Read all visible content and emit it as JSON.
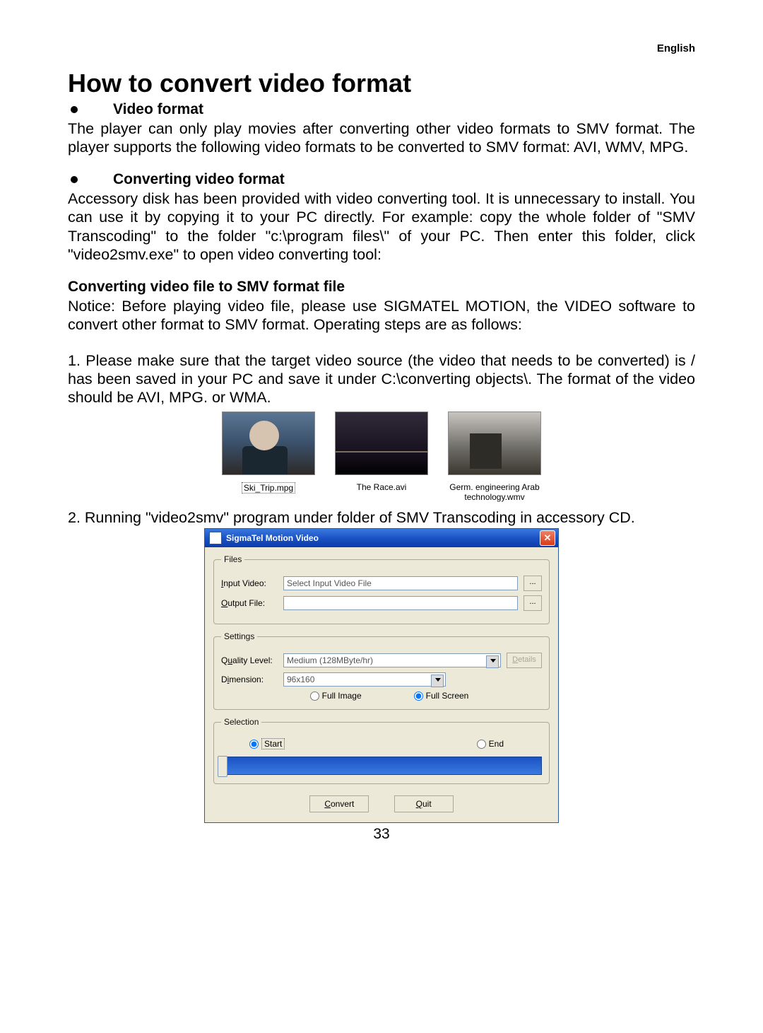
{
  "lang": "English",
  "title": "How to convert video format",
  "section1": {
    "heading": "Video format",
    "text": "The player can only play movies after converting other video formats to SMV format. The player supports the following video formats to be converted to SMV format: AVI, WMV, MPG."
  },
  "section2": {
    "heading": "Converting video format",
    "text": "Accessory disk has been provided with video converting tool. It is unnecessary to install. You can use it by copying it to your PC directly. For example: copy the whole folder of \"SMV Transcoding\" to the folder \"c:\\program files\\\" of your PC. Then enter this folder, click \"video2smv.exe\" to open video converting tool:"
  },
  "section3": {
    "heading": "Converting video file to SMV format file",
    "notice": "Notice: Before playing video file, please use SIGMATEL MOTION, the VIDEO software to convert other format to SMV format. Operating steps are as follows:",
    "step1": "1. Please make sure that the target video source (the video that needs to be converted) is / has been saved in your PC and save it under C:\\converting objects\\. The format of the video should be AVI, MPG. or WMA.",
    "step2": "2. Running \"video2smv\" program under folder of SMV Transcoding in accessory CD."
  },
  "thumbs": [
    {
      "label": "Ski_Trip.mpg"
    },
    {
      "label": "The Race.avi"
    },
    {
      "label": "Germ. engineering Arab technology.wmv"
    }
  ],
  "dialog": {
    "title": "SigmaTel Motion Video",
    "files_legend": "Files",
    "input_label": "Input Video:",
    "input_value": "Select Input Video File",
    "output_label": "Output File:",
    "output_value": "",
    "browse": "...",
    "settings_legend": "Settings",
    "quality_label": "Quality Level:",
    "quality_value": "Medium    (128MByte/hr)",
    "details": "Details",
    "dimension_label": "Dimension:",
    "dimension_value": "96x160",
    "full_image": "Full Image",
    "full_screen": "Full Screen",
    "selection_legend": "Selection",
    "start": "Start",
    "end": "End",
    "convert": "Convert",
    "quit": "Quit"
  },
  "page_number": "33"
}
